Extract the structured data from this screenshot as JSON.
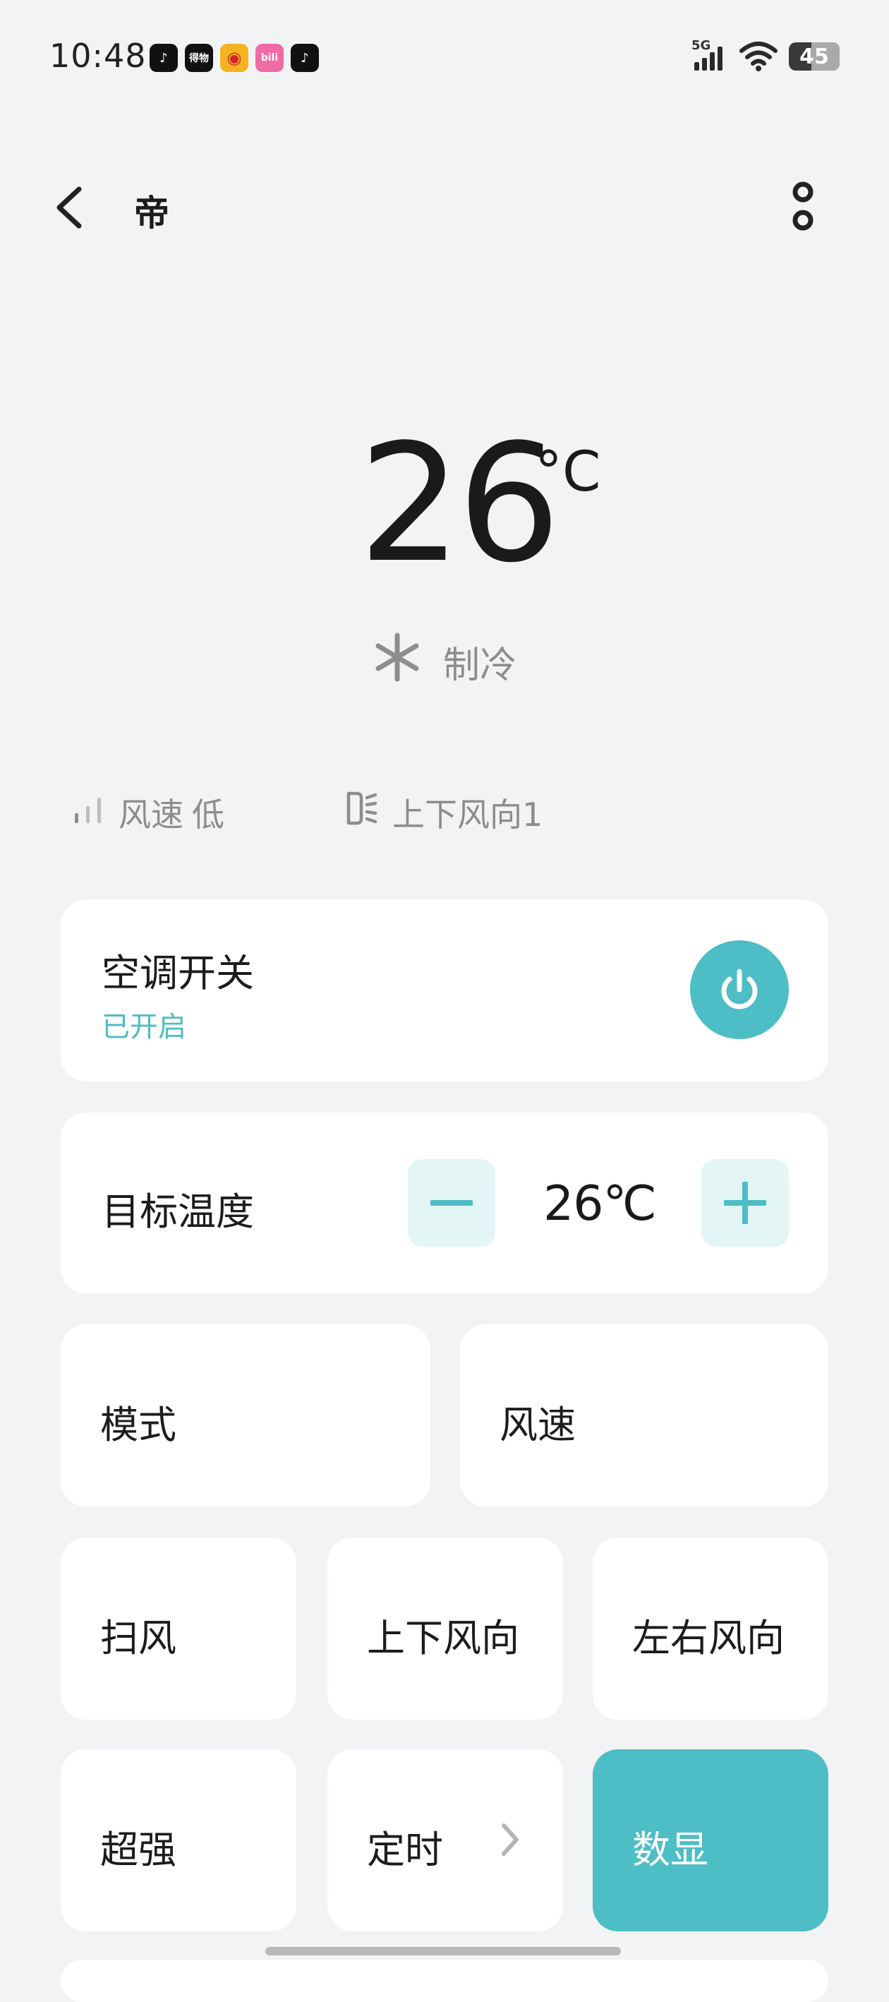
{
  "status_bar": {
    "time": "10:48",
    "apps": [
      {
        "icon": "tiktok-icon",
        "text": "♪",
        "bg": "#111111"
      },
      {
        "icon": "dewu-icon",
        "text": "得物",
        "bg": "#111111"
      },
      {
        "icon": "weibo-icon",
        "text": "◉",
        "bg": "#f5b321"
      },
      {
        "icon": "bilibili-icon",
        "text": "bili",
        "bg": "#f06aa5"
      },
      {
        "icon": "tiktok-icon",
        "text": "♪",
        "bg": "#111111"
      }
    ],
    "network": "5G",
    "battery": "45",
    "battery_level": 0.45
  },
  "header": {
    "title": "帝"
  },
  "display": {
    "temperature": "26",
    "unit": "°C",
    "mode": "制冷",
    "fan_label": "风速",
    "fan_value": "低",
    "vane": "上下风向1"
  },
  "power": {
    "label": "空调开关",
    "status": "已开启"
  },
  "target_temp": {
    "label": "目标温度",
    "value": "26℃"
  },
  "controls": {
    "mode": "模式",
    "fan": "风速",
    "swing": "扫风",
    "updown": "上下风向",
    "leftright": "左右风向",
    "turbo": "超强",
    "timer": "定时",
    "display": "数显"
  },
  "colors": {
    "accent": "#4dbdc6",
    "accent_light": "#e4f5f6",
    "background": "#f2f3f5",
    "muted_text": "#8d8d8d"
  }
}
